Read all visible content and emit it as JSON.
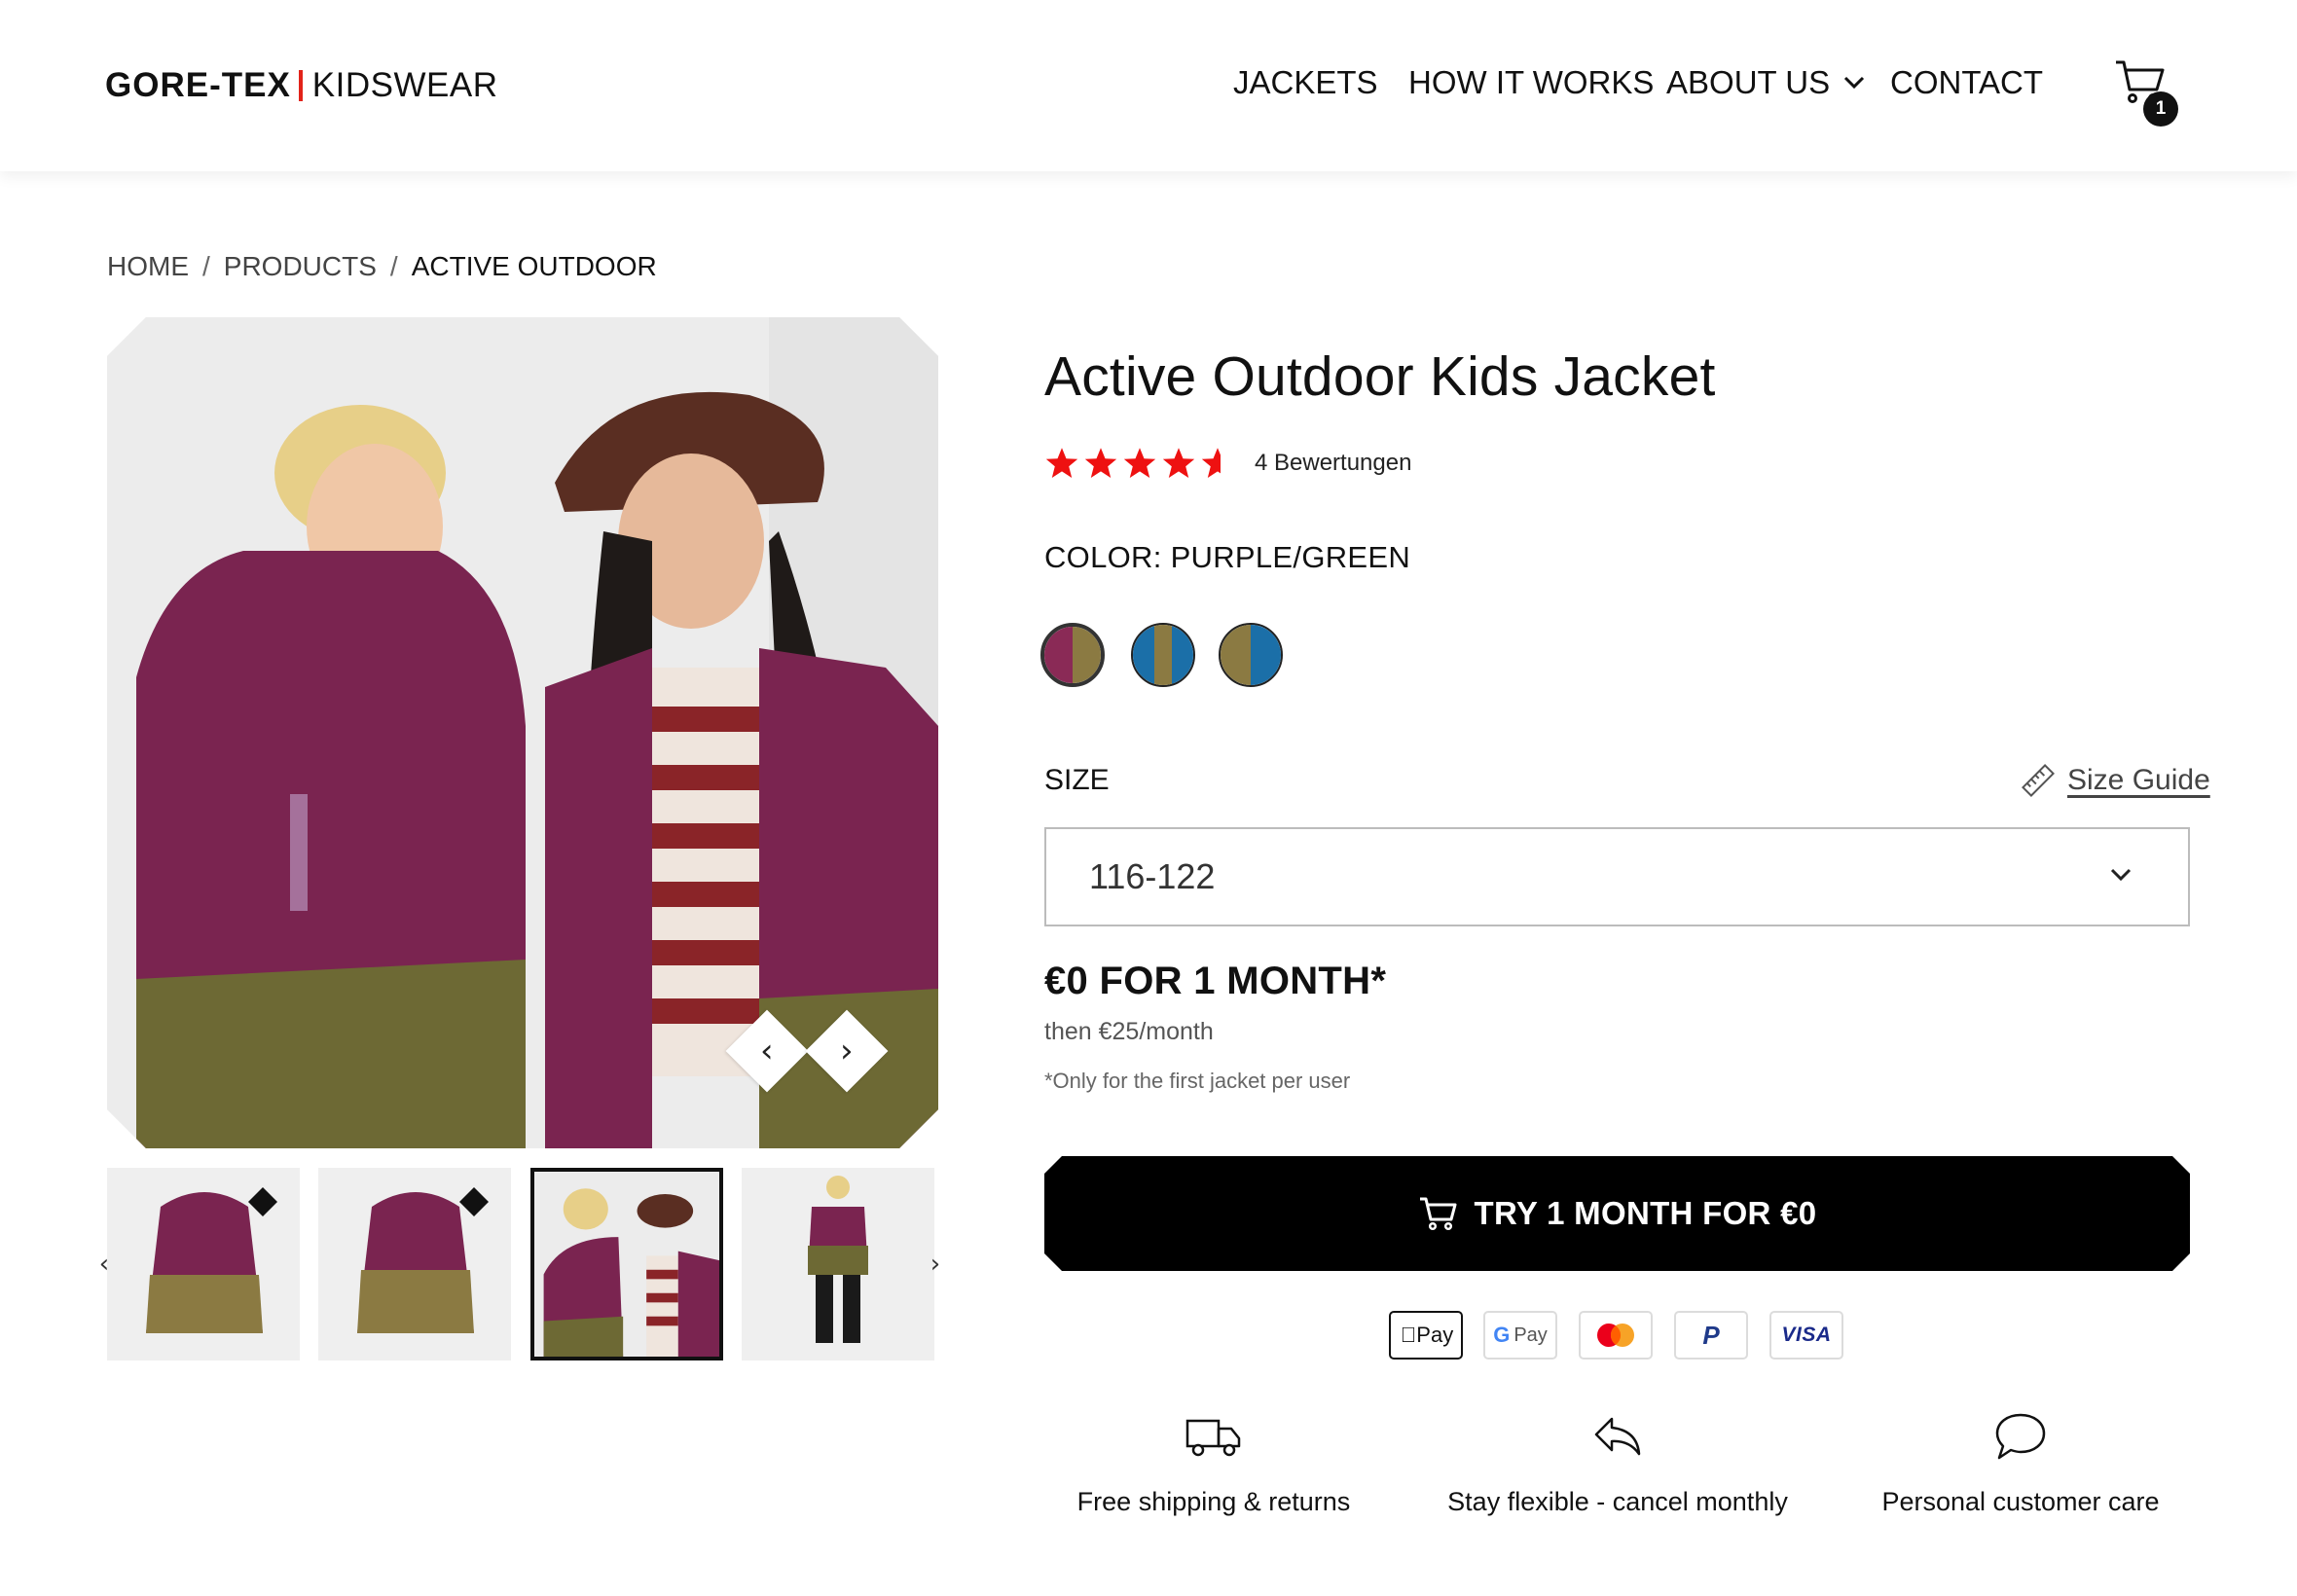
{
  "header": {
    "logo": {
      "brand": "GORE-TEX",
      "sub": "KIDSWEAR"
    },
    "nav": [
      {
        "label": "JACKETS"
      },
      {
        "label": "HOW IT WORKS"
      },
      {
        "label": "ABOUT US",
        "has_dropdown": true
      },
      {
        "label": "CONTACT"
      }
    ],
    "cart": {
      "icon": "cart-icon",
      "count": "1"
    }
  },
  "breadcrumb": {
    "items": [
      "HOME",
      "PRODUCTS",
      "ACTIVE OUTDOOR"
    ],
    "separator": "/"
  },
  "gallery": {
    "main_image": "two-kids-in-purple-green-jackets",
    "prev_icon": "chevron-left-icon",
    "next_icon": "chevron-right-icon",
    "thumbnails": [
      {
        "image": "jacket-front",
        "active": false
      },
      {
        "image": "jacket-back",
        "active": false
      },
      {
        "image": "two-kids",
        "active": true
      },
      {
        "image": "child-full-body",
        "active": false
      }
    ]
  },
  "product": {
    "title": "Active Outdoor Kids Jacket",
    "rating": {
      "value": 4.5,
      "max": 5,
      "review_text": "4 Bewertungen",
      "star_color": "#ee1111"
    },
    "color_label": "COLOR: PURPLE/GREEN",
    "swatches": [
      {
        "name": "purple-green",
        "left": "#8a2a56",
        "right": "#8b7a42",
        "selected": true
      },
      {
        "name": "blue-olive-blue",
        "colors": [
          "#1b6fa8",
          "#8b7a42",
          "#1b6fa8"
        ],
        "selected": false
      },
      {
        "name": "olive-blue",
        "left": "#8b7a42",
        "right": "#1b6fa8",
        "selected": false
      }
    ],
    "size_label": "SIZE",
    "size_guide": "Size Guide",
    "size_value": "116-122",
    "price_main": "€0 FOR 1 MONTH*",
    "price_then": "then €25/month",
    "price_note": "*Only for the first jacket per user",
    "cta_label": "TRY 1 MONTH FOR €0"
  },
  "payments": [
    {
      "name": "Apple Pay",
      "label": "Pay"
    },
    {
      "name": "Google Pay",
      "label": "Pay"
    },
    {
      "name": "Mastercard",
      "label": ""
    },
    {
      "name": "PayPal",
      "label": "P"
    },
    {
      "name": "Visa",
      "label": "VISA"
    }
  ],
  "features": [
    {
      "icon": "truck-icon",
      "label": "Free shipping & returns"
    },
    {
      "icon": "return-arrow-icon",
      "label": "Stay flexible - cancel monthly"
    },
    {
      "icon": "chat-bubble-icon",
      "label": "Personal customer care"
    }
  ],
  "colors": {
    "accent_red": "#e2231a",
    "text": "#111111",
    "cta_bg": "#000000",
    "jacket_purple": "#7d2450",
    "jacket_olive": "#6f6a35"
  }
}
